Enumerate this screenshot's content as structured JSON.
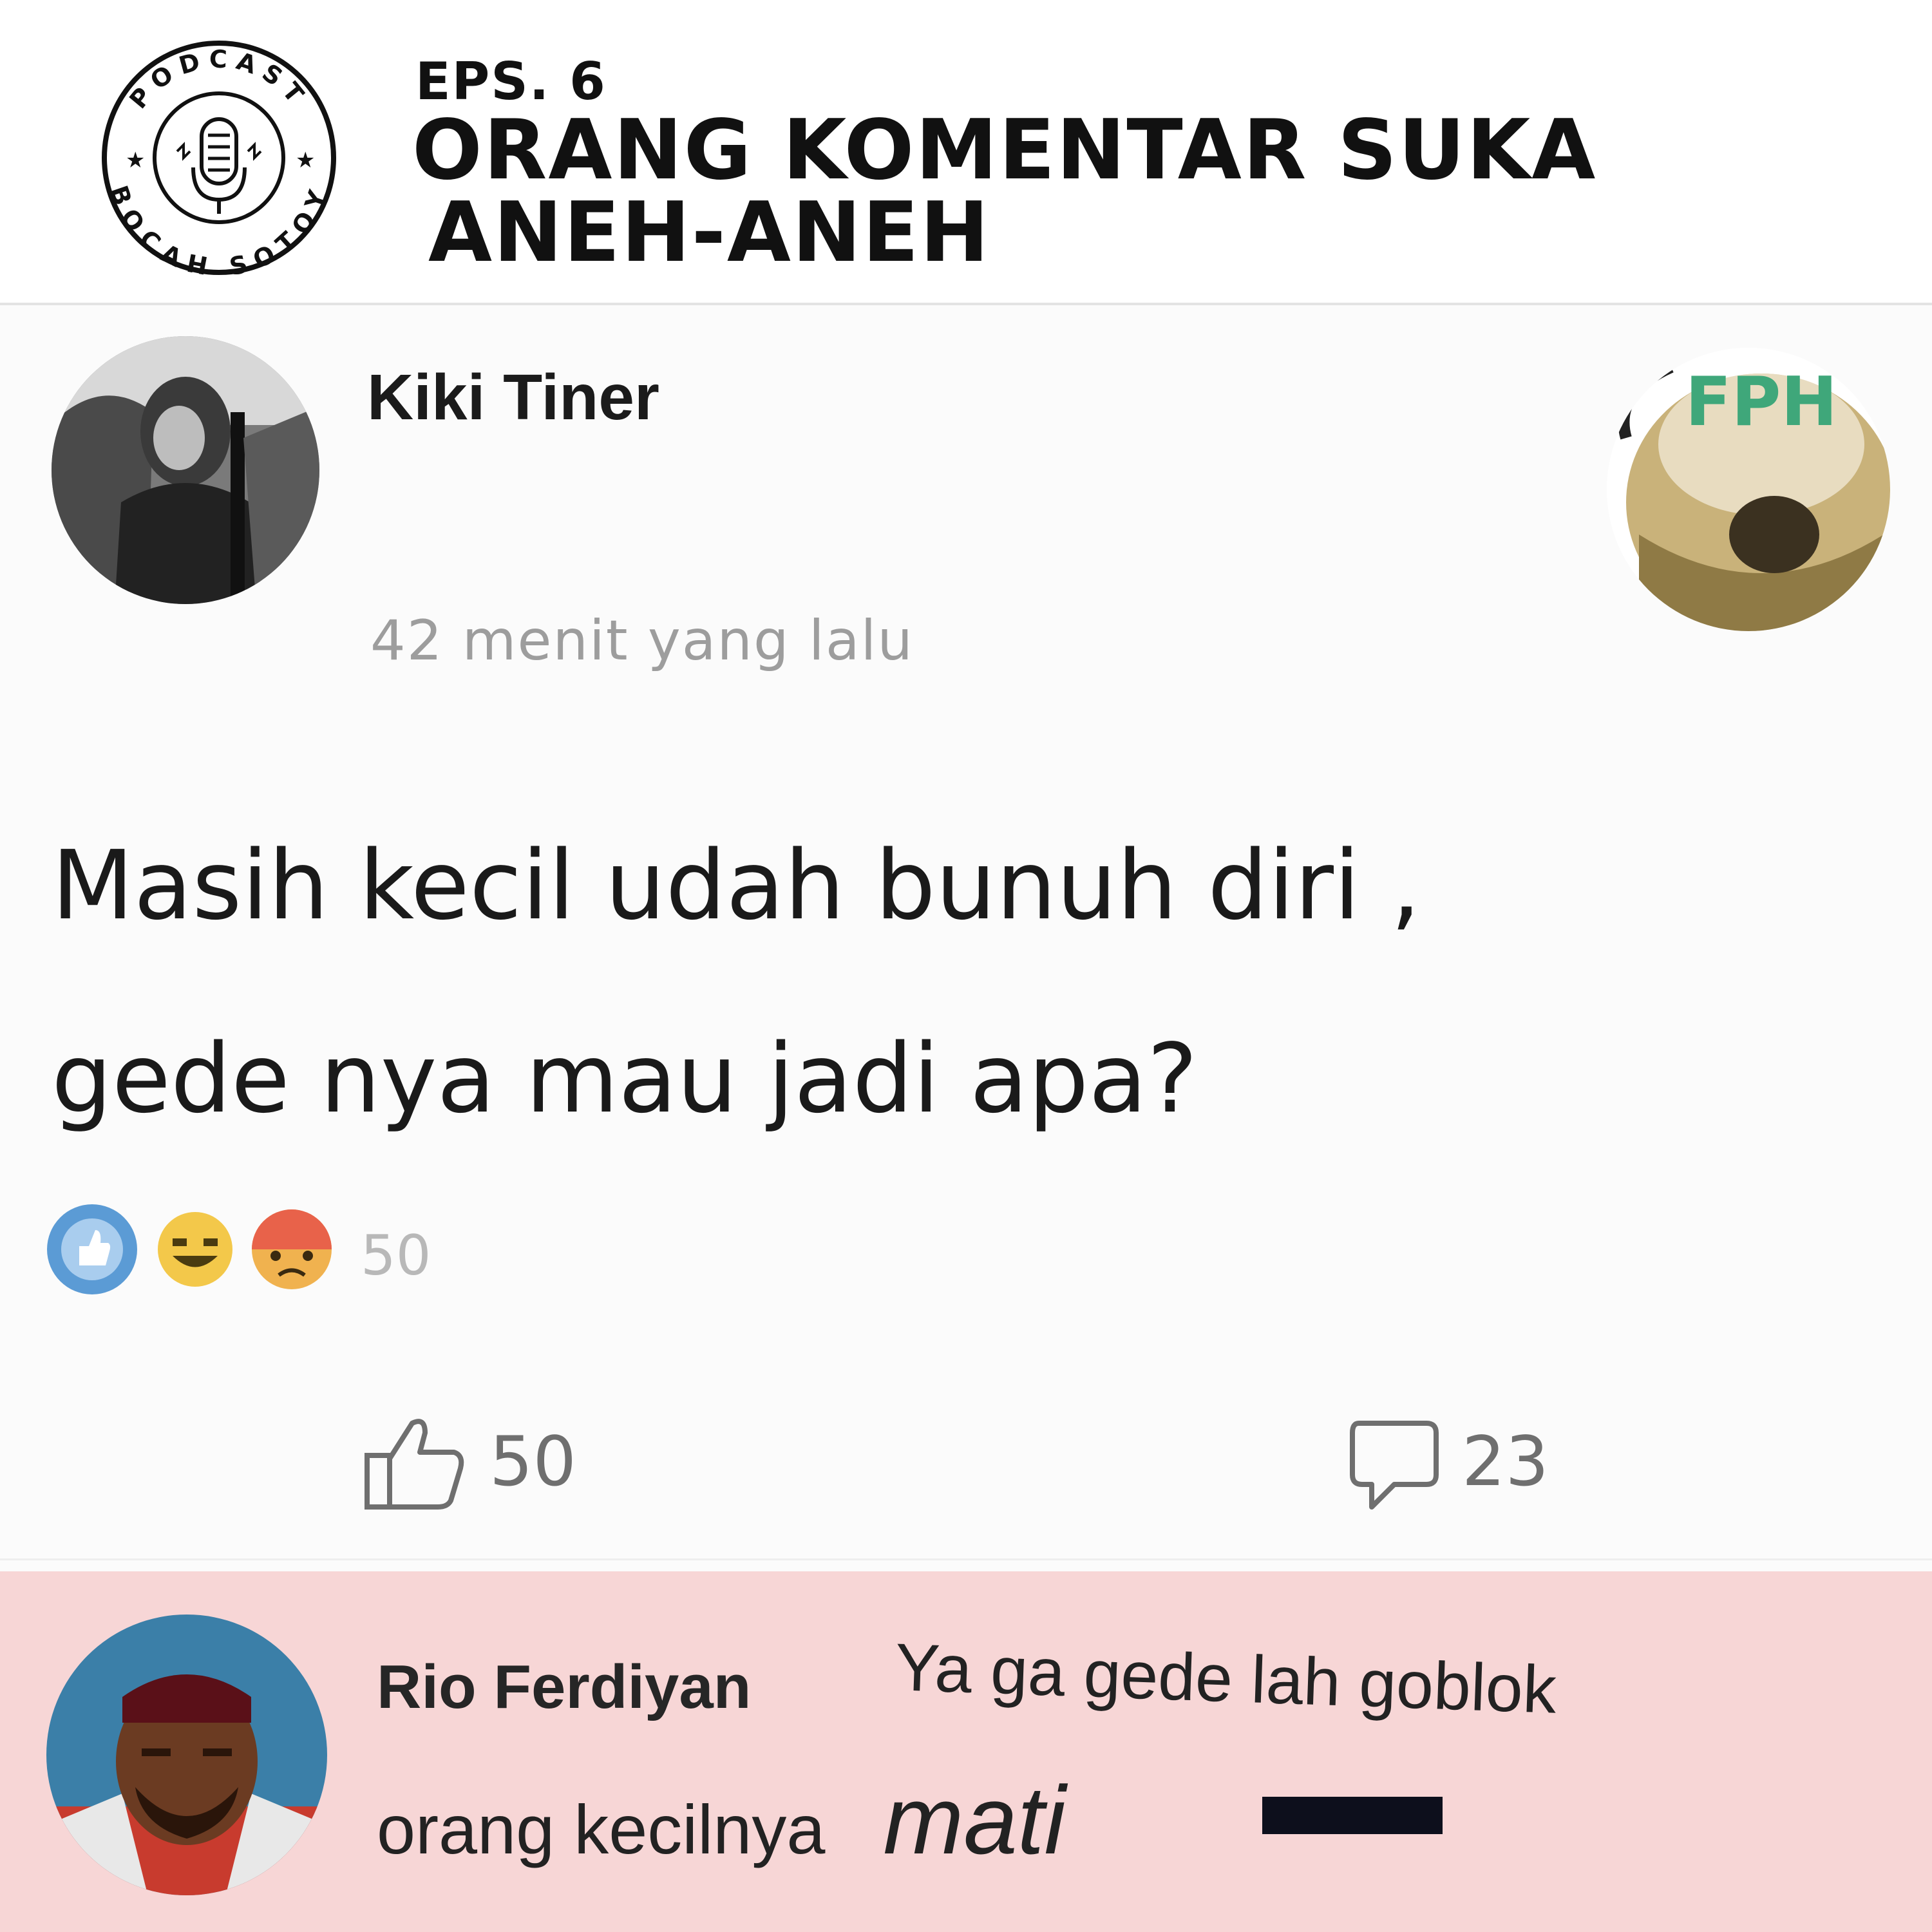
{
  "header": {
    "episode": "EPS. 6",
    "title_line1": "ORANG KOMENTAR SUKA",
    "title_line2": "ANEH-ANEH",
    "logo": {
      "top_text": "PODCAST",
      "bottom_text": "BOCAH SOTOY",
      "icon": "microphone-icon"
    }
  },
  "post": {
    "author": "Kiki Tiner",
    "badge": "FPH",
    "timestamp": "42 menit yang lalu",
    "body_line1": "Masih kecil udah bunuh diri ,",
    "body_line2": "gede nya mau jadi apa?",
    "reactions": {
      "icons": [
        "like-reaction-icon",
        "haha-reaction-icon",
        "angry-reaction-icon"
      ],
      "count": "50"
    },
    "actions": {
      "like_icon": "thumbs-up-icon",
      "like_count": "50",
      "comment_icon": "comment-bubble-icon",
      "comment_count": "23"
    }
  },
  "comment": {
    "author": "Rio Ferdiyan",
    "text_line1": "Ya ga gede lah goblok",
    "text_line2_part1": "orang kecilnya",
    "text_line2_part2": "mati"
  },
  "colors": {
    "comment_background": "#f7d6d6",
    "like_blue": "#5b9bd5",
    "censor_bar": "#0d0f1c",
    "badge_green": "#3fa77a"
  }
}
